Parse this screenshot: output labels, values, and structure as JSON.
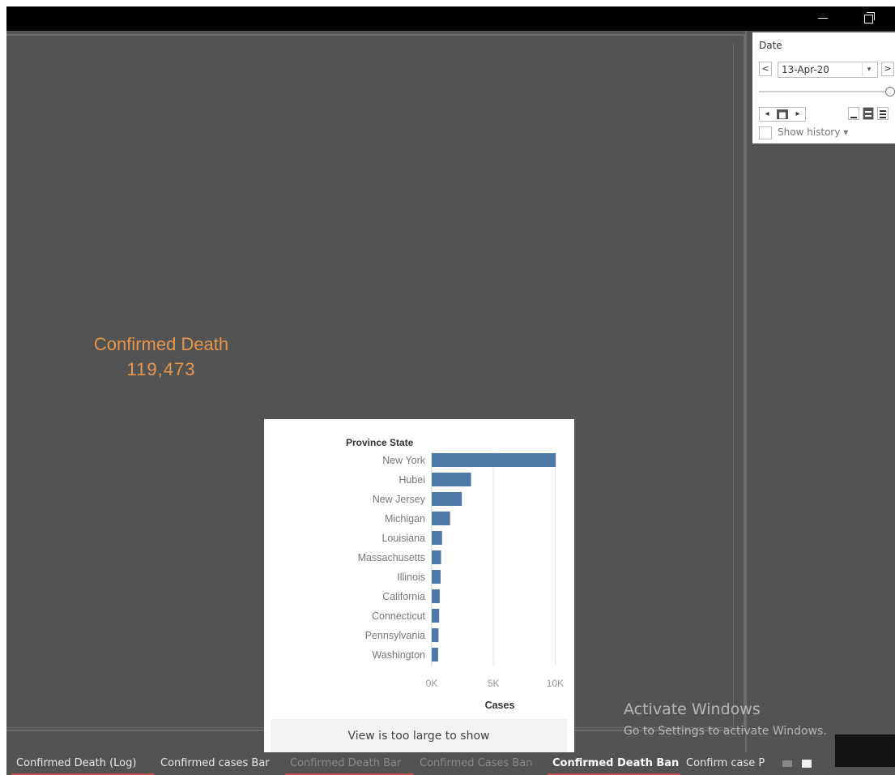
{
  "kpi": {
    "label": "Confirmed Death",
    "value": "119,473"
  },
  "date_filter": {
    "title": "Date",
    "prev_label": "<",
    "next_label": ">",
    "selected": "13-Apr-20",
    "dropdown_label": "▾",
    "slider_value": 1.0,
    "play_labels": [
      "◂",
      "■",
      "▸"
    ],
    "show_history_label": "Show history ▾"
  },
  "tooltip": {
    "header": "Province State",
    "footer": "View is too large to show"
  },
  "chart_data": {
    "type": "bar",
    "orientation": "horizontal",
    "title": "",
    "ylabel": "Province State",
    "xlabel": "Cases",
    "categories": [
      "New York",
      "Hubei",
      "New Jersey",
      "Michigan",
      "Louisiana",
      "Massachusetts",
      "Illinois",
      "California",
      "Connecticut",
      "Pennsylvania",
      "Washington"
    ],
    "values": [
      10056,
      3186,
      2443,
      1487,
      840,
      757,
      720,
      650,
      602,
      550,
      520
    ],
    "xlim": [
      0,
      10500
    ],
    "xticks": [
      0,
      5000,
      10000
    ],
    "xtick_labels": [
      "0K",
      "5K",
      "10K"
    ],
    "bar_color": "#4e79a7",
    "grid": true
  },
  "watermark": {
    "line1": "Activate Windows",
    "line2": "Go to Settings to activate Windows."
  },
  "tabs": [
    {
      "label": "Confirmed Death  (Log)",
      "state": "normal"
    },
    {
      "label": "Confirmed cases Bar",
      "state": "normal"
    },
    {
      "label": "Confirmed Death Bar",
      "state": "dim"
    },
    {
      "label": "Confirmed Cases Ban",
      "state": "dim"
    },
    {
      "label": "Confirmed Death Ban",
      "state": "active"
    },
    {
      "label": "Confirm case P",
      "state": "normal"
    }
  ]
}
